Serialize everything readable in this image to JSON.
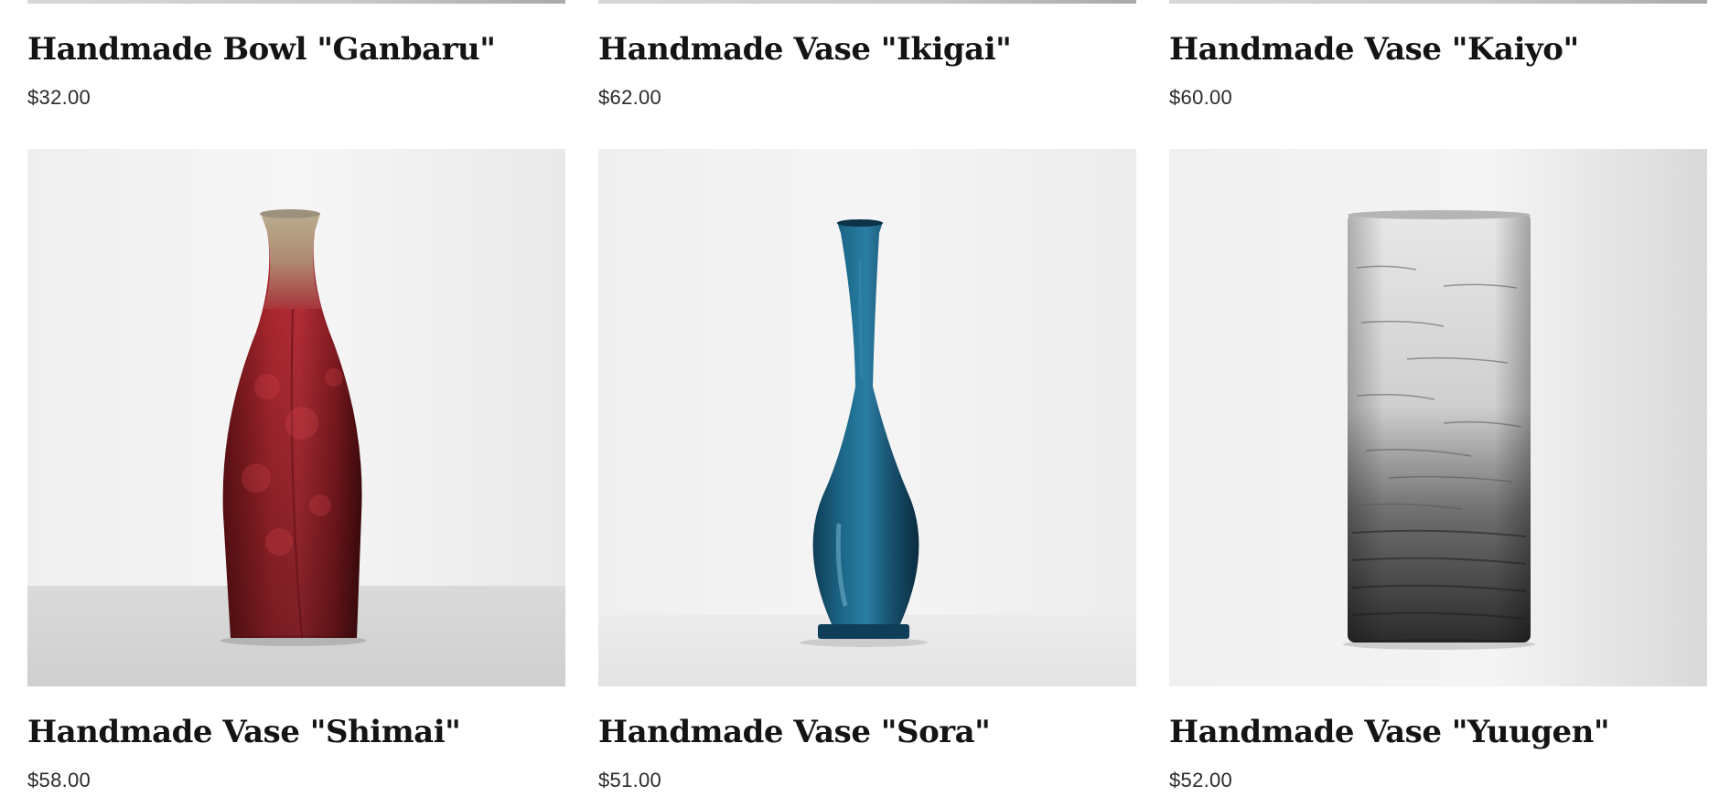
{
  "products": [
    {
      "title": "Handmade Bowl \"Ganbaru\"",
      "price": "$32.00"
    },
    {
      "title": "Handmade Vase \"Ikigai\"",
      "price": "$62.00"
    },
    {
      "title": "Handmade Vase \"Kaiyo\"",
      "price": "$60.00"
    },
    {
      "title": "Handmade Vase \"Shimai\"",
      "price": "$58.00",
      "image_subject": "red-bottle-vase"
    },
    {
      "title": "Handmade Vase \"Sora\"",
      "price": "$51.00",
      "image_subject": "blue-bud-vase"
    },
    {
      "title": "Handmade Vase \"Yuugen\"",
      "price": "$52.00",
      "image_subject": "birch-cylinder-vase"
    }
  ],
  "colors": {
    "title_text": "#141414",
    "price_text": "#2b2b2b",
    "background": "#ffffff"
  }
}
